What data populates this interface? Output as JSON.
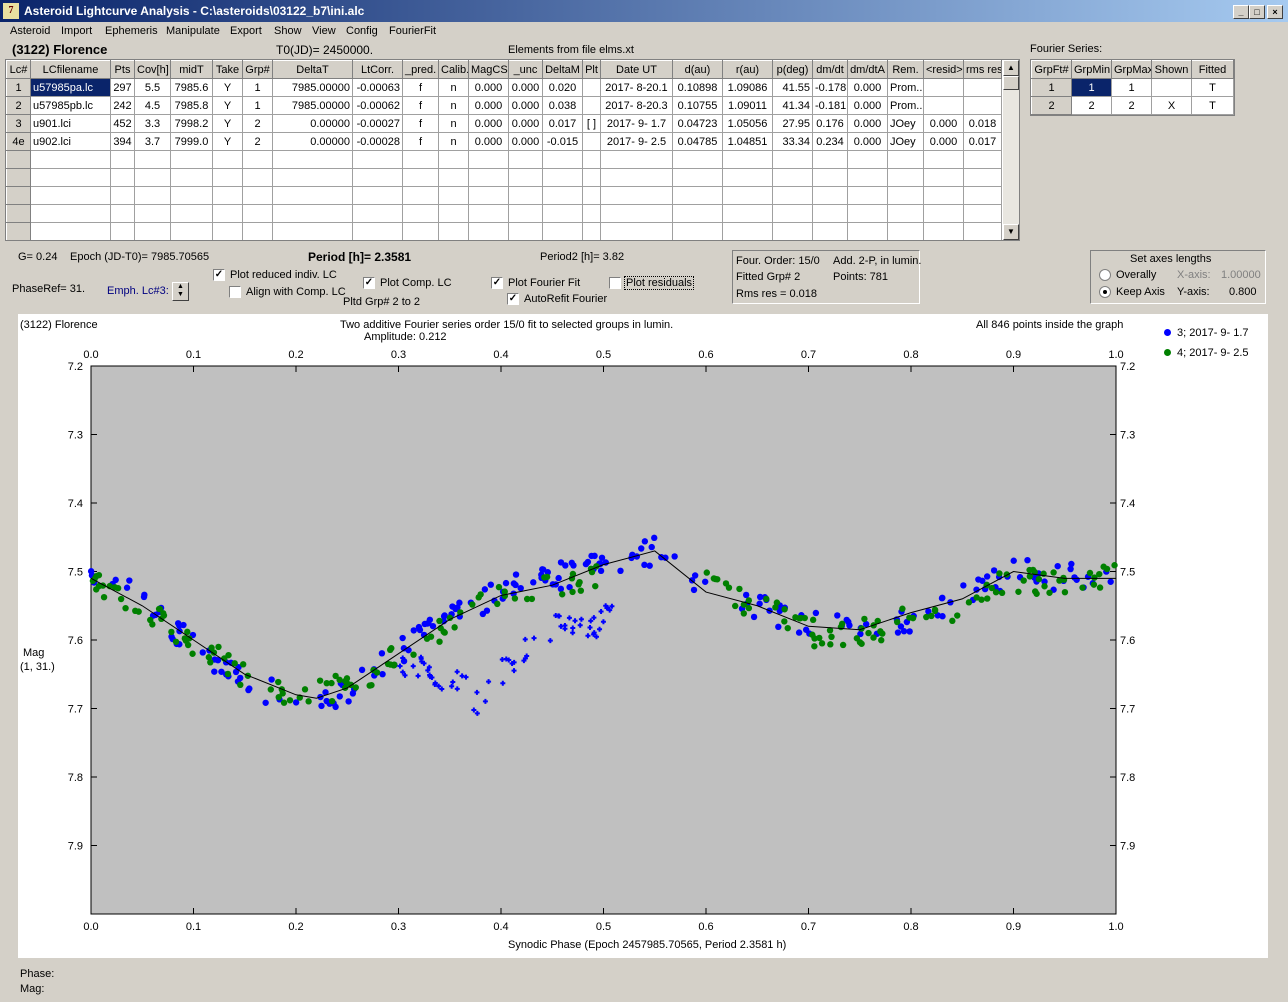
{
  "window": {
    "title": "Asteroid Lightcurve Analysis - C:\\asteroids\\03122_b7\\ini.alc",
    "app_icon": "7"
  },
  "menu": [
    "Asteroid",
    "Import",
    "Ephemeris",
    "Manipulate",
    "Export",
    "Show",
    "View",
    "Config",
    "FourierFit"
  ],
  "asteroid_name": "(3122) Florence",
  "t0": "T0(JD)= 2450000.",
  "elements_from": "Elements from file elms.xt",
  "fourier_series_label": "Fourier Series:",
  "lc_table": {
    "headers": [
      "Lc#",
      "LCfilename",
      "Pts",
      "Cov[h]",
      "midT",
      "Take",
      "Grp#",
      "DeltaT",
      "LtCorr.",
      "_pred.",
      "Calib.",
      "MagCS",
      "_unc",
      "DeltaM",
      "Plt",
      "Date UT",
      "d(au)",
      "r(au)",
      "p(deg)",
      "dm/dt",
      "dm/dtA",
      "Rem.",
      "<resid>",
      "rms res"
    ],
    "rows": [
      [
        "1",
        "u57985pa.lc",
        "297",
        "5.5",
        "7985.6",
        "Y",
        "1",
        "7985.00000",
        "-0.00063",
        "f",
        "n",
        "0.000",
        "0.000",
        "0.020",
        "",
        "2017- 8-20.1",
        "0.10898",
        "1.09086",
        "41.55",
        "-0.178",
        "0.000",
        "Prom...",
        "",
        ""
      ],
      [
        "2",
        "u57985pb.lc",
        "242",
        "4.5",
        "7985.8",
        "Y",
        "1",
        "7985.00000",
        "-0.00062",
        "f",
        "n",
        "0.000",
        "0.000",
        "0.038",
        "",
        "2017- 8-20.3",
        "0.10755",
        "1.09011",
        "41.34",
        "-0.181",
        "0.000",
        "Prom...",
        "",
        ""
      ],
      [
        "3",
        "u901.lci",
        "452",
        "3.3",
        "7998.2",
        "Y",
        "2",
        "0.00000",
        "-0.00027",
        "f",
        "n",
        "0.000",
        "0.000",
        "0.017",
        "[ ]",
        "2017- 9- 1.7",
        "0.04723",
        "1.05056",
        "27.95",
        "0.176",
        "0.000",
        "JOey",
        "0.000",
        "0.018"
      ],
      [
        "4e",
        "u902.lci",
        "394",
        "3.7",
        "7999.0",
        "Y",
        "2",
        "0.00000",
        "-0.00028",
        "f",
        "n",
        "0.000",
        "0.000",
        "-0.015",
        "",
        "2017- 9- 2.5",
        "0.04785",
        "1.04851",
        "33.34",
        "0.234",
        "0.000",
        "JOey",
        "0.000",
        "0.017"
      ]
    ]
  },
  "fourier_table": {
    "headers": [
      "GrpFt#",
      "GrpMin",
      "GrpMax",
      "Shown",
      "Fitted"
    ],
    "rows": [
      [
        "1",
        "1",
        "1",
        "",
        "T"
      ],
      [
        "2",
        "2",
        "2",
        "X",
        "T"
      ]
    ]
  },
  "controls": {
    "g": "G= 0.24",
    "epoch": "Epoch (JD-T0)= 7985.70565",
    "period": "Period [h]= 2.3581",
    "period2": "Period2 [h]= 3.82",
    "phaseref": "PhaseRef= 31.",
    "emph": "Emph. Lc#3:",
    "cb_plot_reduced": "Plot reduced indiv. LC",
    "cb_align": "Align with Comp. LC",
    "cb_plot_comp": "Plot Comp. LC",
    "pltd_grp": "Pltd Grp#  2  to  2",
    "cb_plot_fourier": "Plot Fourier Fit",
    "cb_plot_residuals": "Plot residuals",
    "cb_autorefit": "AutoRefit Fourier",
    "four_order": "Four. Order: 15/0",
    "add": "Add. 2-P, in lumin.",
    "fitted_grp": "Fitted Grp# 2",
    "points": "Points: 781",
    "rms": "Rms res      = 0.018",
    "axes_title": "Set axes lengths",
    "overally": "Overally",
    "keep_axis": "Keep Axis",
    "xaxis_label": "X-axis:",
    "xaxis_val": "1.00000",
    "yaxis_label": "Y-axis:",
    "yaxis_val": "0.800"
  },
  "status": {
    "phase": "Phase:",
    "mag": "Mag:"
  },
  "chart_data": {
    "type": "scatter",
    "title_left": "(3122) Florence",
    "title": "Two additive Fourier series order 15/0 fit to selected groups in lumin.",
    "subtitle": "Amplitude: 0.212",
    "note": "All 846 points inside the graph",
    "xlabel": "Synodic Phase (Epoch 2457985.70565, Period 2.3581 h)",
    "ylabel": "Mag",
    "ylabel2": "(1, 31.)",
    "xlim": [
      0,
      1
    ],
    "ylim": [
      7.2,
      8.0
    ],
    "y_inverted": true,
    "xticks": [
      "0.0",
      "0.1",
      "0.2",
      "0.3",
      "0.4",
      "0.5",
      "0.6",
      "0.7",
      "0.8",
      "0.9",
      "1.0"
    ],
    "yticks": [
      "7.2",
      "7.3",
      "7.4",
      "7.5",
      "7.6",
      "7.7",
      "7.8",
      "7.9"
    ],
    "legend": "top-right",
    "series": [
      {
        "name": "3; 2017- 9- 1.7",
        "color": "#0000ff",
        "marker": "circle",
        "curve": [
          [
            0,
            7.5
          ],
          [
            0.05,
            7.54
          ],
          [
            0.1,
            7.61
          ],
          [
            0.15,
            7.66
          ],
          [
            0.2,
            7.69
          ],
          [
            0.25,
            7.68
          ],
          [
            0.3,
            7.62
          ],
          [
            0.35,
            7.57
          ],
          [
            0.4,
            7.53
          ],
          [
            0.45,
            7.51
          ],
          [
            0.5,
            7.49
          ],
          [
            0.55,
            7.47
          ],
          [
            0.6,
            7.52
          ],
          [
            0.65,
            7.55
          ],
          [
            0.7,
            7.58
          ],
          [
            0.75,
            7.58
          ],
          [
            0.8,
            7.57
          ],
          [
            0.85,
            7.54
          ],
          [
            0.9,
            7.5
          ],
          [
            0.95,
            7.51
          ],
          [
            1.0,
            7.5
          ]
        ],
        "gaps": [
          [
            0.6,
            0.62
          ]
        ]
      },
      {
        "name": "4; 2017- 9- 2.5",
        "color": "#008000",
        "marker": "circle",
        "curve": [
          [
            0,
            7.52
          ],
          [
            0.05,
            7.55
          ],
          [
            0.1,
            7.61
          ],
          [
            0.15,
            7.65
          ],
          [
            0.2,
            7.68
          ],
          [
            0.25,
            7.67
          ],
          [
            0.3,
            7.62
          ],
          [
            0.35,
            7.58
          ],
          [
            0.4,
            7.53
          ],
          [
            0.45,
            7.52
          ],
          [
            0.5,
            7.5
          ],
          [
            0.55,
            7.49
          ],
          [
            0.6,
            7.52
          ],
          [
            0.65,
            7.55
          ],
          [
            0.7,
            7.59
          ],
          [
            0.75,
            7.59
          ],
          [
            0.8,
            7.57
          ],
          [
            0.85,
            7.55
          ],
          [
            0.9,
            7.51
          ],
          [
            0.95,
            7.52
          ],
          [
            1.0,
            7.51
          ]
        ],
        "gaps": [
          [
            0.5,
            0.6
          ]
        ]
      },
      {
        "name": "",
        "color": "#0000ff",
        "marker": "cross",
        "curve": [
          [
            0.3,
            7.63
          ],
          [
            0.33,
            7.65
          ],
          [
            0.36,
            7.66
          ],
          [
            0.38,
            7.7
          ],
          [
            0.4,
            7.65
          ],
          [
            0.42,
            7.62
          ],
          [
            0.44,
            7.6
          ],
          [
            0.46,
            7.57
          ],
          [
            0.48,
            7.59
          ],
          [
            0.5,
            7.57
          ],
          [
            0.51,
            7.55
          ]
        ],
        "gaps": []
      }
    ],
    "fit_curve": [
      [
        0,
        7.51
      ],
      [
        0.05,
        7.55
      ],
      [
        0.1,
        7.6
      ],
      [
        0.15,
        7.65
      ],
      [
        0.2,
        7.68
      ],
      [
        0.22,
        7.685
      ],
      [
        0.25,
        7.67
      ],
      [
        0.3,
        7.62
      ],
      [
        0.35,
        7.57
      ],
      [
        0.4,
        7.535
      ],
      [
        0.45,
        7.52
      ],
      [
        0.5,
        7.49
      ],
      [
        0.55,
        7.47
      ],
      [
        0.6,
        7.53
      ],
      [
        0.65,
        7.55
      ],
      [
        0.7,
        7.58
      ],
      [
        0.75,
        7.585
      ],
      [
        0.8,
        7.56
      ],
      [
        0.85,
        7.54
      ],
      [
        0.9,
        7.5
      ],
      [
        0.95,
        7.51
      ],
      [
        1.0,
        7.51
      ]
    ]
  }
}
